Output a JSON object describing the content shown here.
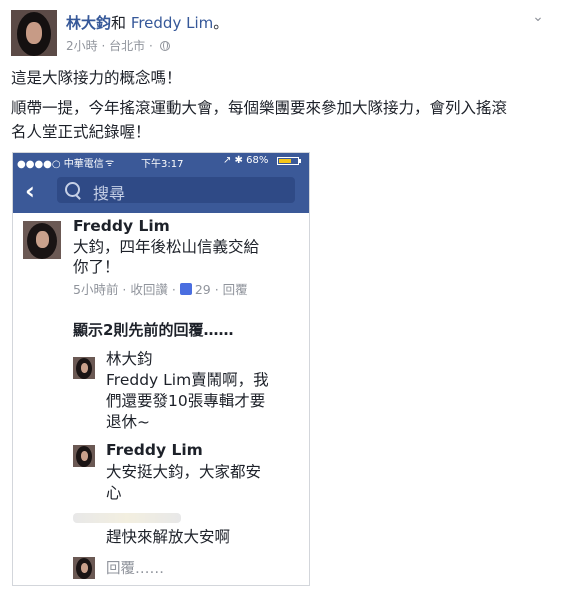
{
  "post": {
    "author": "林大鈞",
    "with_word": "和",
    "tagged": "Freddy Lim",
    "period": "。",
    "time": "2小時",
    "separator": "·",
    "location": "台北市",
    "separator2": "·",
    "line1": "這是大隊接力的概念嗎！",
    "line2": "順帶一提，今年搖滾運動大會，每個樂團要來參加大隊接力，會列入搖滾",
    "line3": "名人堂正式紀錄喔！"
  },
  "phone": {
    "carrier": "●●●●○ 中華電信",
    "wifi": "ᯤ",
    "clock": "下午3:17",
    "right_status": "↗ ✱ 68%",
    "battery_percent": 68,
    "back_glyph": "‹",
    "search_placeholder": "搜尋"
  },
  "comment_main": {
    "name": "Freddy Lim",
    "text1": "大鈞，四年後松山信義交給",
    "text2": "你了！",
    "meta_time": "5小時前",
    "meta_read": "收回讚",
    "likes": "29",
    "meta_reply": "回覆"
  },
  "earlier_replies": "顯示2則先前的回覆……",
  "replies": [
    {
      "name": "林大鈞",
      "text1": "Freddy Lim賣鬧啊，我",
      "text2": "們還要發10張專輯才要",
      "text3": "退休~"
    },
    {
      "name": "Freddy Lim",
      "text1": "大安挺大鈞，大家都安",
      "text2": "心"
    },
    {
      "text1": "趕快來解放大安啊"
    }
  ],
  "reply_link": "回覆……",
  "icons": {
    "chevron": "chevron-down-icon",
    "globe": "globe-icon",
    "like": "like-thumb-icon"
  },
  "colors": {
    "facebook_blue": "#3b5998",
    "link_blue": "#365899",
    "meta_grey": "#90949c"
  }
}
